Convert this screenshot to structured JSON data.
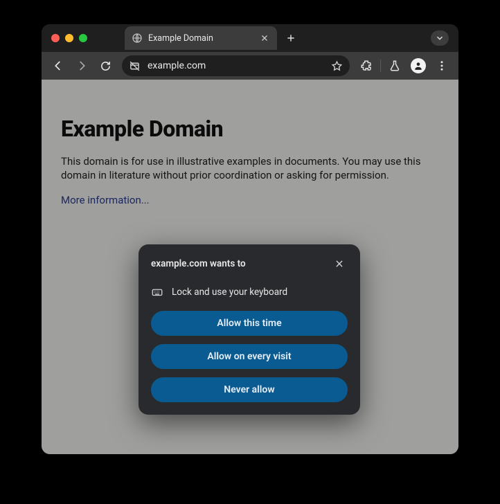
{
  "tab": {
    "title": "Example Domain"
  },
  "omnibox": {
    "url": "example.com"
  },
  "page": {
    "heading": "Example Domain",
    "paragraph": "This domain is for use in illustrative examples in documents. You may use this domain in literature without prior coordination or asking for permission.",
    "more_link": "More information..."
  },
  "dialog": {
    "title": "example.com wants to",
    "permission_label": "Lock and use your keyboard",
    "btn_allow_once": "Allow this time",
    "btn_allow_every": "Allow on every visit",
    "btn_never": "Never allow"
  }
}
